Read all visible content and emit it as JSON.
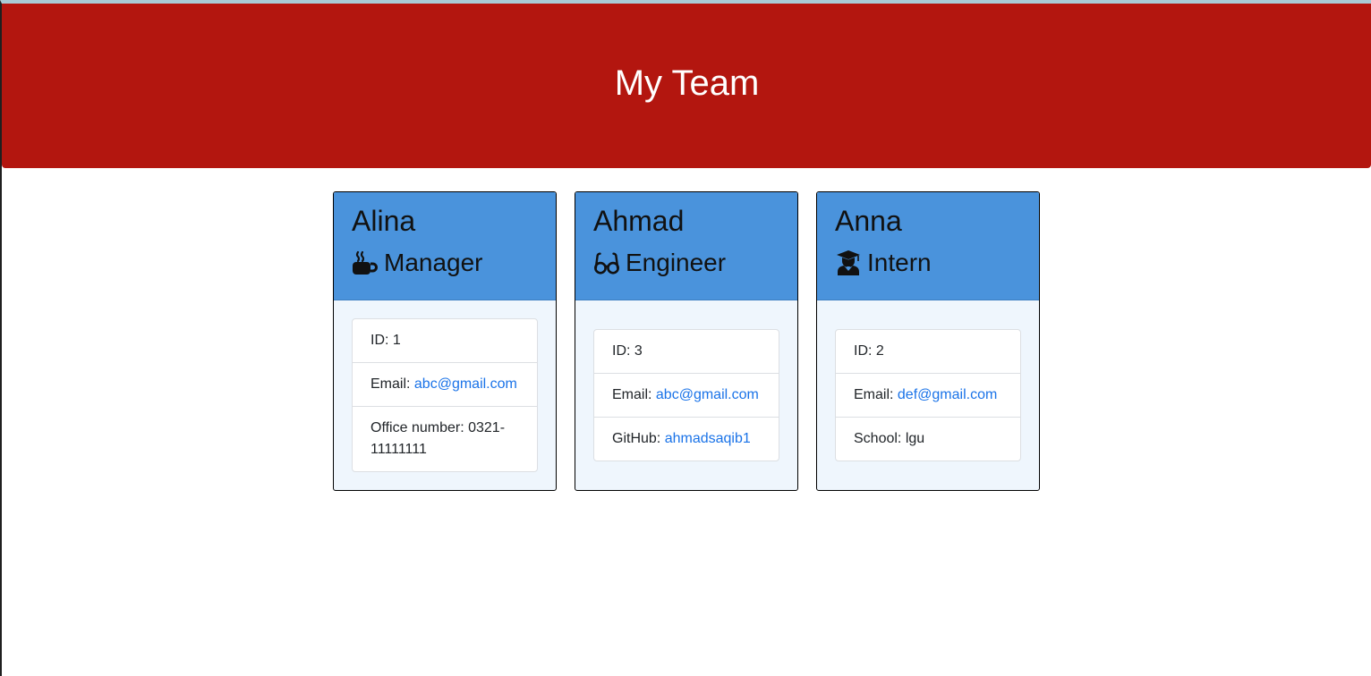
{
  "header": {
    "title": "My Team"
  },
  "team": [
    {
      "name": "Alina",
      "role": "Manager",
      "icon": "mug-icon",
      "id_label": "ID:",
      "id": "1",
      "email_label": "Email:",
      "email": "abc@gmail.com",
      "extra_label": "Office number:",
      "extra_value": "0321-11111111"
    },
    {
      "name": "Ahmad",
      "role": "Engineer",
      "icon": "glasses-icon",
      "id_label": "ID:",
      "id": "3",
      "email_label": "Email:",
      "email": "abc@gmail.com",
      "extra_label": "GitHub:",
      "extra_value": "ahmadsaqib1"
    },
    {
      "name": "Anna",
      "role": "Intern",
      "icon": "graduate-icon",
      "id_label": "ID:",
      "id": "2",
      "email_label": "Email:",
      "email": "def@gmail.com",
      "extra_label": "School:",
      "extra_value": "lgu"
    }
  ],
  "colors": {
    "header_bg": "#b3160f",
    "card_header_bg": "#4a93dc",
    "card_body_bg": "#eff6fd",
    "link": "#1a73e8"
  }
}
